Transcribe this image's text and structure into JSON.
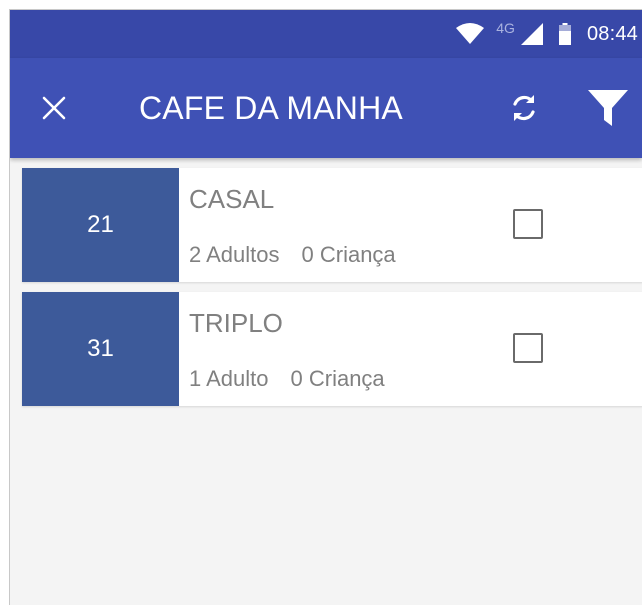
{
  "status_bar": {
    "network": "4G",
    "time": "08:44",
    "icons": [
      "wifi-icon",
      "signal-icon",
      "battery-icon"
    ]
  },
  "app_bar": {
    "title": "CAFE DA MANHA",
    "close_icon": "close-icon",
    "refresh_icon": "refresh-icon",
    "filter_icon": "filter-icon"
  },
  "rooms": [
    {
      "number": "21",
      "type": "CASAL",
      "adults": "2 Adultos",
      "children": "0 Criança",
      "checked": false
    },
    {
      "number": "31",
      "type": "TRIPLO",
      "adults": "1 Adulto",
      "children": "0 Criança",
      "checked": false
    }
  ],
  "colors": {
    "status_bar": "#3848a8",
    "app_bar": "#3f51b5",
    "room_number_bg": "#3d5a9a",
    "background": "#f4f4f4"
  }
}
